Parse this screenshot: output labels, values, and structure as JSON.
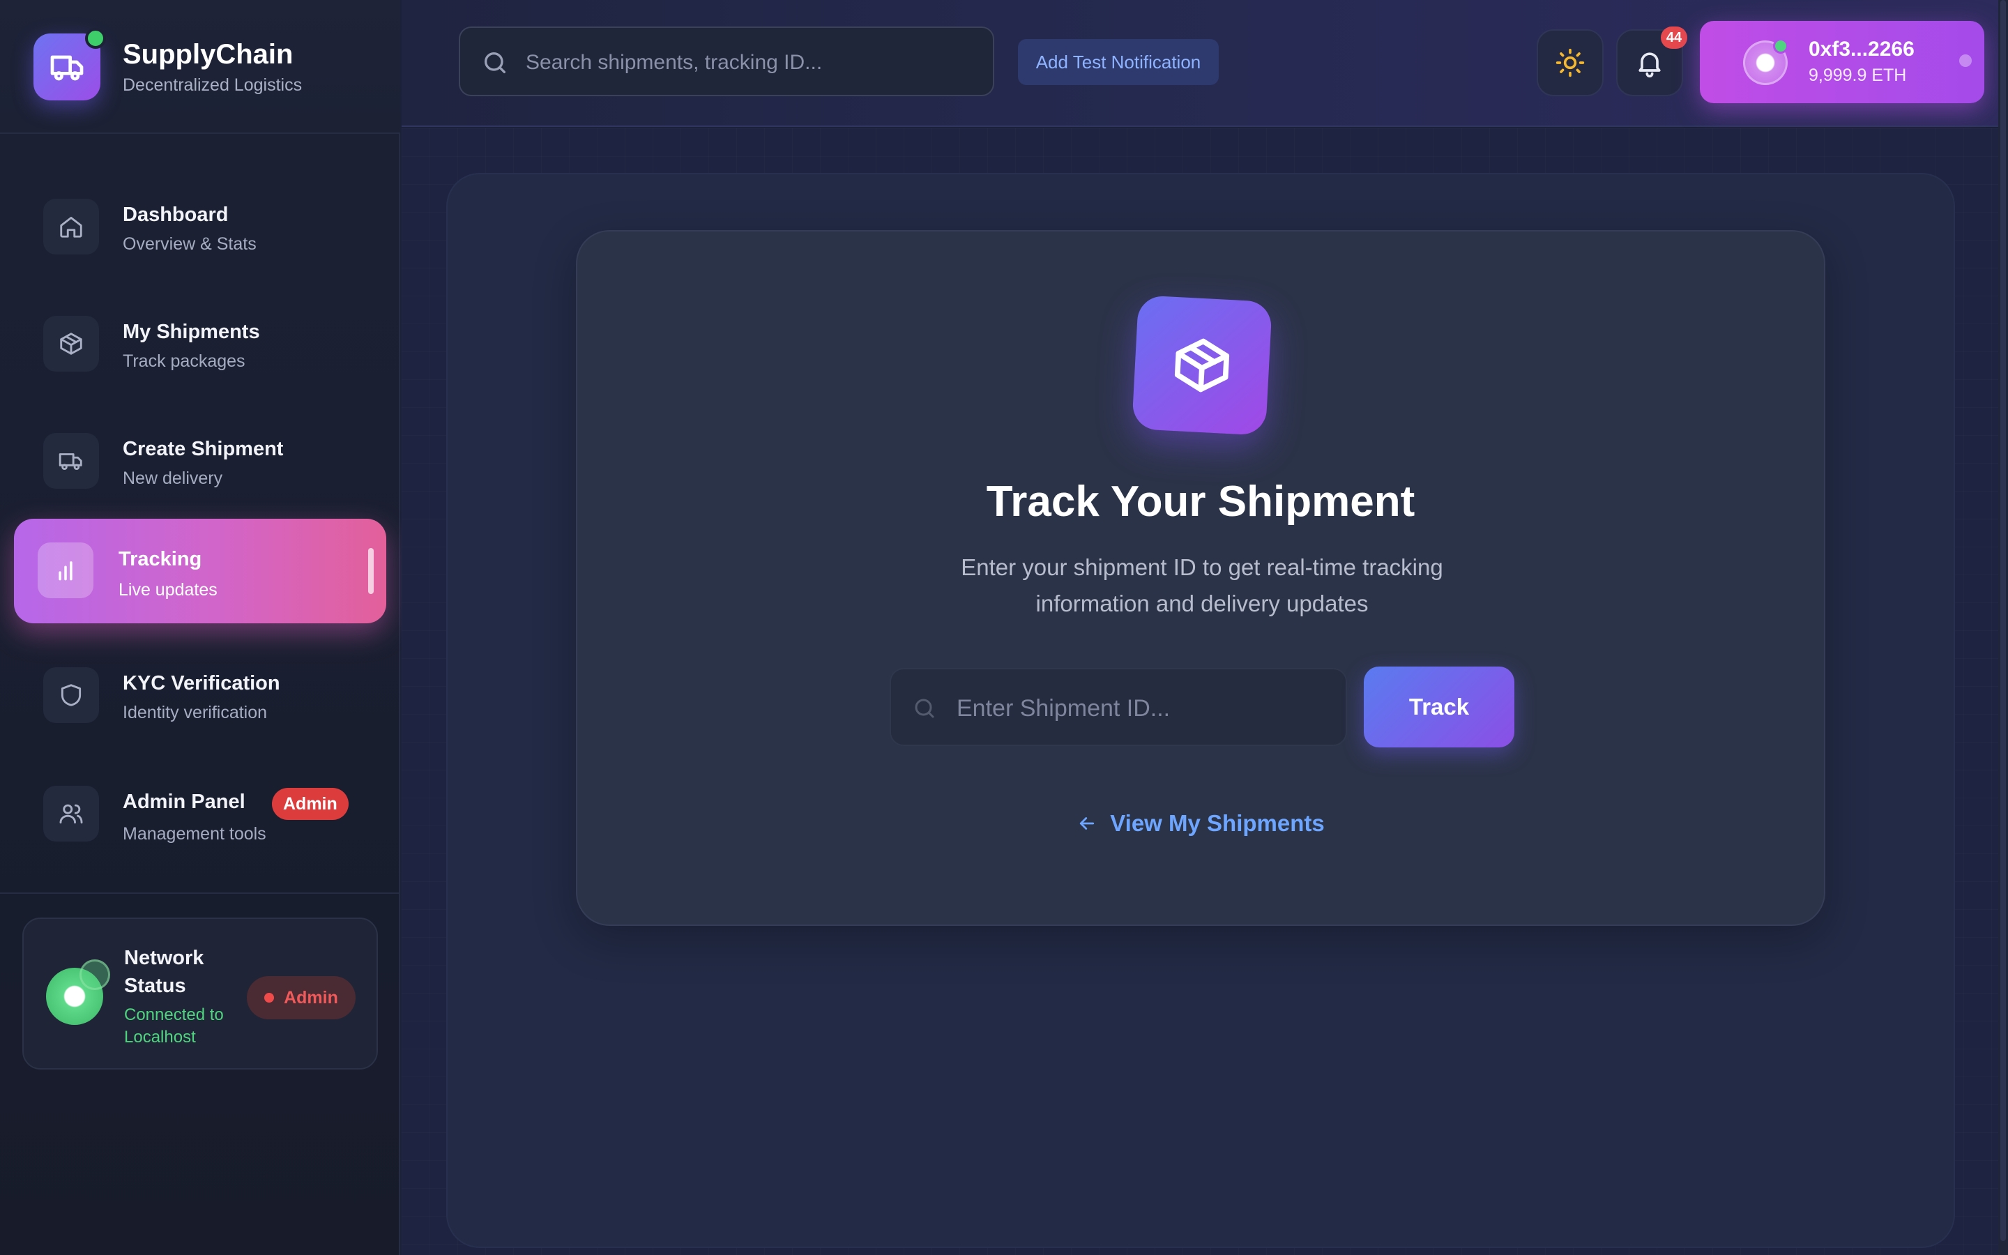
{
  "brand": {
    "title": "SupplyChain",
    "subtitle": "Decentralized Logistics"
  },
  "sidebar": {
    "items": [
      {
        "title": "Dashboard",
        "subtitle": "Overview & Stats",
        "icon": "home-icon"
      },
      {
        "title": "My Shipments",
        "subtitle": "Track packages",
        "icon": "box-icon"
      },
      {
        "title": "Create Shipment",
        "subtitle": "New delivery",
        "icon": "truck-icon"
      },
      {
        "title": "Tracking",
        "subtitle": "Live updates",
        "icon": "bar-chart-icon",
        "active": true
      },
      {
        "title": "KYC Verification",
        "subtitle": "Identity verification",
        "icon": "shield-icon"
      },
      {
        "title": "Admin Panel",
        "subtitle": "Management tools",
        "icon": "users-icon",
        "badge": "Admin"
      }
    ],
    "network": {
      "title": "Network Status",
      "status": "Connected to Localhost",
      "badge": "Admin"
    }
  },
  "topbar": {
    "search_placeholder": "Search shipments, tracking ID...",
    "test_notification_label": "Add Test Notification",
    "notification_count": "44",
    "wallet": {
      "address": "0xf3...2266",
      "balance": "9,999.9 ETH"
    }
  },
  "main": {
    "title": "Track Your Shipment",
    "subtitle": "Enter your shipment ID to get real-time tracking information and delivery updates",
    "input_placeholder": "Enter Shipment ID...",
    "track_label": "Track",
    "view_link": "View My Shipments"
  },
  "colors": {
    "accent_purple": "#a148e6",
    "accent_blue": "#5a7bf0",
    "active_gradient_end": "#e3609a",
    "status_green": "#4fd47f",
    "danger_red": "#dc3c3c",
    "link_blue": "#6ea6ff"
  }
}
